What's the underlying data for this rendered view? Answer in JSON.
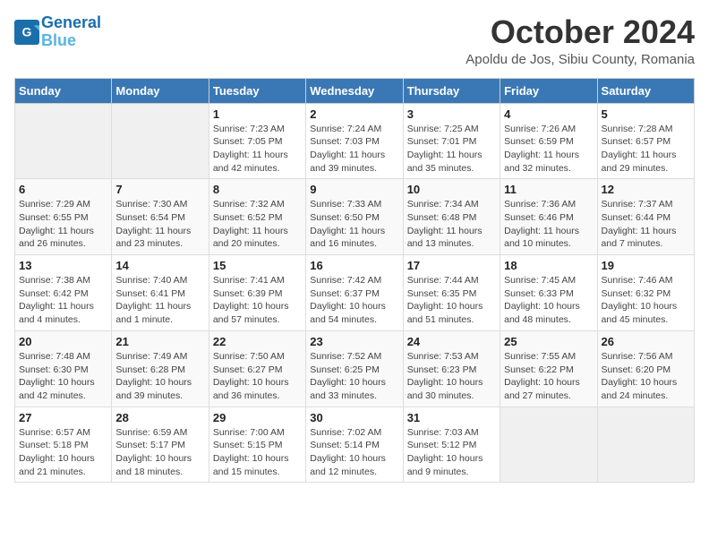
{
  "header": {
    "logo_line1": "General",
    "logo_line2": "Blue",
    "month": "October 2024",
    "location": "Apoldu de Jos, Sibiu County, Romania"
  },
  "days_of_week": [
    "Sunday",
    "Monday",
    "Tuesday",
    "Wednesday",
    "Thursday",
    "Friday",
    "Saturday"
  ],
  "weeks": [
    [
      {
        "day": "",
        "info": ""
      },
      {
        "day": "",
        "info": ""
      },
      {
        "day": "1",
        "info": "Sunrise: 7:23 AM\nSunset: 7:05 PM\nDaylight: 11 hours and 42 minutes."
      },
      {
        "day": "2",
        "info": "Sunrise: 7:24 AM\nSunset: 7:03 PM\nDaylight: 11 hours and 39 minutes."
      },
      {
        "day": "3",
        "info": "Sunrise: 7:25 AM\nSunset: 7:01 PM\nDaylight: 11 hours and 35 minutes."
      },
      {
        "day": "4",
        "info": "Sunrise: 7:26 AM\nSunset: 6:59 PM\nDaylight: 11 hours and 32 minutes."
      },
      {
        "day": "5",
        "info": "Sunrise: 7:28 AM\nSunset: 6:57 PM\nDaylight: 11 hours and 29 minutes."
      }
    ],
    [
      {
        "day": "6",
        "info": "Sunrise: 7:29 AM\nSunset: 6:55 PM\nDaylight: 11 hours and 26 minutes."
      },
      {
        "day": "7",
        "info": "Sunrise: 7:30 AM\nSunset: 6:54 PM\nDaylight: 11 hours and 23 minutes."
      },
      {
        "day": "8",
        "info": "Sunrise: 7:32 AM\nSunset: 6:52 PM\nDaylight: 11 hours and 20 minutes."
      },
      {
        "day": "9",
        "info": "Sunrise: 7:33 AM\nSunset: 6:50 PM\nDaylight: 11 hours and 16 minutes."
      },
      {
        "day": "10",
        "info": "Sunrise: 7:34 AM\nSunset: 6:48 PM\nDaylight: 11 hours and 13 minutes."
      },
      {
        "day": "11",
        "info": "Sunrise: 7:36 AM\nSunset: 6:46 PM\nDaylight: 11 hours and 10 minutes."
      },
      {
        "day": "12",
        "info": "Sunrise: 7:37 AM\nSunset: 6:44 PM\nDaylight: 11 hours and 7 minutes."
      }
    ],
    [
      {
        "day": "13",
        "info": "Sunrise: 7:38 AM\nSunset: 6:42 PM\nDaylight: 11 hours and 4 minutes."
      },
      {
        "day": "14",
        "info": "Sunrise: 7:40 AM\nSunset: 6:41 PM\nDaylight: 11 hours and 1 minute."
      },
      {
        "day": "15",
        "info": "Sunrise: 7:41 AM\nSunset: 6:39 PM\nDaylight: 10 hours and 57 minutes."
      },
      {
        "day": "16",
        "info": "Sunrise: 7:42 AM\nSunset: 6:37 PM\nDaylight: 10 hours and 54 minutes."
      },
      {
        "day": "17",
        "info": "Sunrise: 7:44 AM\nSunset: 6:35 PM\nDaylight: 10 hours and 51 minutes."
      },
      {
        "day": "18",
        "info": "Sunrise: 7:45 AM\nSunset: 6:33 PM\nDaylight: 10 hours and 48 minutes."
      },
      {
        "day": "19",
        "info": "Sunrise: 7:46 AM\nSunset: 6:32 PM\nDaylight: 10 hours and 45 minutes."
      }
    ],
    [
      {
        "day": "20",
        "info": "Sunrise: 7:48 AM\nSunset: 6:30 PM\nDaylight: 10 hours and 42 minutes."
      },
      {
        "day": "21",
        "info": "Sunrise: 7:49 AM\nSunset: 6:28 PM\nDaylight: 10 hours and 39 minutes."
      },
      {
        "day": "22",
        "info": "Sunrise: 7:50 AM\nSunset: 6:27 PM\nDaylight: 10 hours and 36 minutes."
      },
      {
        "day": "23",
        "info": "Sunrise: 7:52 AM\nSunset: 6:25 PM\nDaylight: 10 hours and 33 minutes."
      },
      {
        "day": "24",
        "info": "Sunrise: 7:53 AM\nSunset: 6:23 PM\nDaylight: 10 hours and 30 minutes."
      },
      {
        "day": "25",
        "info": "Sunrise: 7:55 AM\nSunset: 6:22 PM\nDaylight: 10 hours and 27 minutes."
      },
      {
        "day": "26",
        "info": "Sunrise: 7:56 AM\nSunset: 6:20 PM\nDaylight: 10 hours and 24 minutes."
      }
    ],
    [
      {
        "day": "27",
        "info": "Sunrise: 6:57 AM\nSunset: 5:18 PM\nDaylight: 10 hours and 21 minutes."
      },
      {
        "day": "28",
        "info": "Sunrise: 6:59 AM\nSunset: 5:17 PM\nDaylight: 10 hours and 18 minutes."
      },
      {
        "day": "29",
        "info": "Sunrise: 7:00 AM\nSunset: 5:15 PM\nDaylight: 10 hours and 15 minutes."
      },
      {
        "day": "30",
        "info": "Sunrise: 7:02 AM\nSunset: 5:14 PM\nDaylight: 10 hours and 12 minutes."
      },
      {
        "day": "31",
        "info": "Sunrise: 7:03 AM\nSunset: 5:12 PM\nDaylight: 10 hours and 9 minutes."
      },
      {
        "day": "",
        "info": ""
      },
      {
        "day": "",
        "info": ""
      }
    ]
  ]
}
